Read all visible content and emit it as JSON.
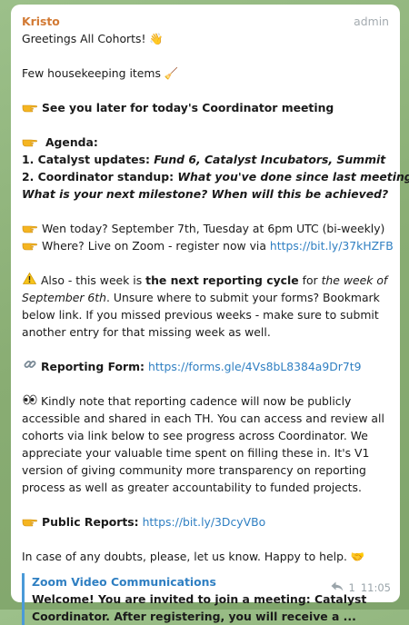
{
  "message": {
    "sender": "Kristo",
    "role": "admin",
    "greeting": "Greetings All Cohorts! 👋",
    "housekeeping": "Few housekeeping items 🧹",
    "see_later": "See you later for today's Coordinator meeting",
    "agenda_title": "Agenda:",
    "agenda_1_prefix": "1. Catalyst updates: ",
    "agenda_1_items": "Fund 6, Catalyst Incubators, Summit",
    "agenda_2_prefix": "2. Coordinator standup: ",
    "agenda_2_q1": "What you've done since last meeting?",
    "agenda_2_q2": "What is your next milestone? When will this be achieved?",
    "when": "Wen today? September 7th, Tuesday at 6pm UTC (bi-weekly)",
    "where_prefix": "Where? Live on Zoom - register now via ",
    "where_link": "https://bit.ly/37kHZFB",
    "also_prefix": "Also - this week is ",
    "also_bold": "the next reporting cycle",
    "also_for": " for ",
    "also_week_1": "the week of",
    "also_week_2": "September 6th",
    "also_rest_1": ". Unsure where to submit your forms? Bookmark",
    "also_rest_2": "below link. If you missed previous weeks - make sure to submit",
    "also_rest_3": "another entry for that missing week as well.",
    "reporting_label": "Reporting Form:",
    "reporting_link": "https://forms.gle/4Vs8bL8384a9Dr7t9",
    "kindly_1": "Kindly note that reporting cadence will now be publicly",
    "kindly_2": "accessible and shared in each TH. You can access and review all",
    "kindly_3": "cohorts via link below to see progress across Coordinator. We",
    "kindly_4": "appreciate your valuable time spent on filling these in. It's V1",
    "kindly_5": "version of giving community more transparency on reporting",
    "kindly_6": "process as well as greater accountability to funded projects.",
    "public_label": "Public Reports:",
    "public_link": "https://bit.ly/3DcyVBo",
    "doubts": "In case of any doubts, please, let us know. Happy to help. 🤝"
  },
  "link_preview": {
    "site": "Zoom Video Communications",
    "desc_1": "Welcome! You are invited to join a meeting: Catalyst",
    "desc_2": "Coordinator. After registering, you will receive a ..."
  },
  "meta": {
    "reply_count": "1",
    "time": "11:05",
    "reply_icon": "reply-arrow-icon"
  },
  "colors": {
    "sender": "#d27a34",
    "link": "#2f7fc2",
    "preview_bar": "#4a9ad8",
    "background": "#8fb37a"
  }
}
